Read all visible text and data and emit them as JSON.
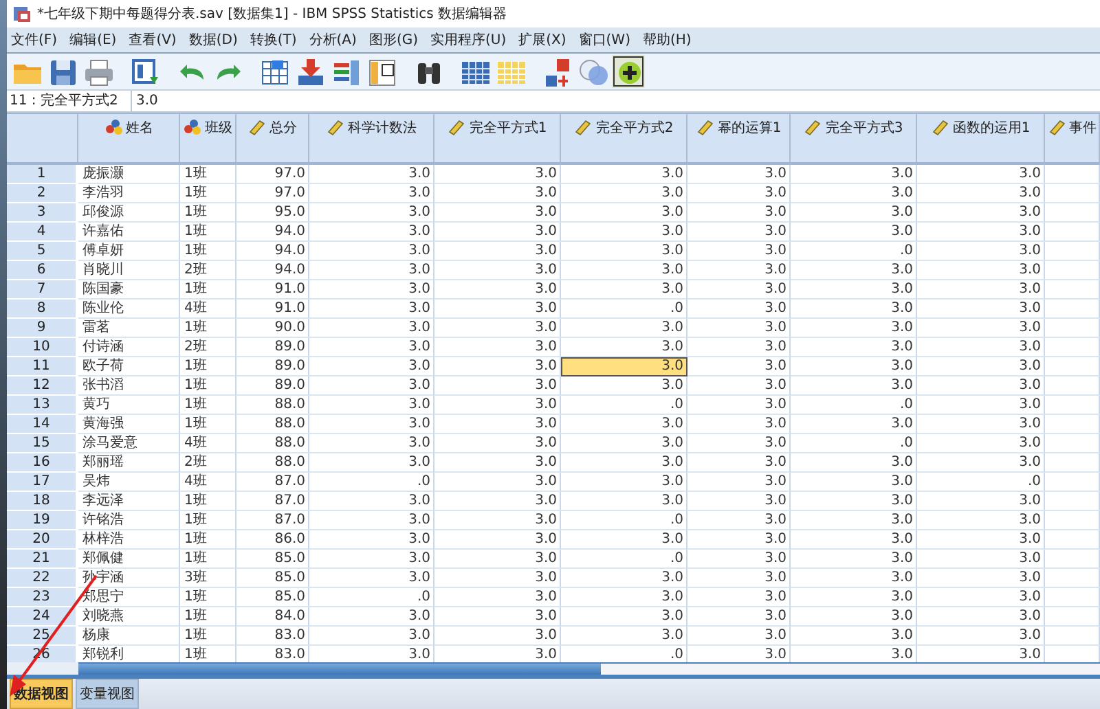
{
  "window": {
    "title": "*七年级下期中每题得分表.sav [数据集1] - IBM SPSS Statistics 数据编辑器"
  },
  "menu": [
    "文件(F)",
    "编辑(E)",
    "查看(V)",
    "数据(D)",
    "转换(T)",
    "分析(A)",
    "图形(G)",
    "实用程序(U)",
    "扩展(X)",
    "窗口(W)",
    "帮助(H)"
  ],
  "cell_editor": {
    "cell": "11 : 完全平方式2",
    "value": "3.0"
  },
  "table": {
    "columns": [
      {
        "label": "姓名",
        "kind": "nominal"
      },
      {
        "label": "班级",
        "kind": "nominal"
      },
      {
        "label": "总分",
        "kind": "scale"
      },
      {
        "label": "科学计数法",
        "kind": "scale"
      },
      {
        "label": "完全平方式1",
        "kind": "scale"
      },
      {
        "label": "完全平方式2",
        "kind": "scale"
      },
      {
        "label": "幂的运算1",
        "kind": "scale"
      },
      {
        "label": "完全平方式3",
        "kind": "scale"
      },
      {
        "label": "函数的运用1",
        "kind": "scale"
      },
      {
        "label": "事件",
        "kind": "scale"
      }
    ],
    "rows": [
      {
        "number": "1",
        "cells": [
          {
            "text": "庞振灏",
            "selected": false
          },
          {
            "text": "1班",
            "selected": false
          },
          {
            "text": "97.0",
            "selected": false
          },
          {
            "text": "3.0",
            "selected": false
          },
          {
            "text": "3.0",
            "selected": false
          },
          {
            "text": "3.0",
            "selected": false
          },
          {
            "text": "3.0",
            "selected": false
          },
          {
            "text": "3.0",
            "selected": false
          },
          {
            "text": "3.0",
            "selected": false
          }
        ]
      },
      {
        "number": "2",
        "cells": [
          {
            "text": "李浩羽",
            "selected": false
          },
          {
            "text": "1班",
            "selected": false
          },
          {
            "text": "97.0",
            "selected": false
          },
          {
            "text": "3.0",
            "selected": false
          },
          {
            "text": "3.0",
            "selected": false
          },
          {
            "text": "3.0",
            "selected": false
          },
          {
            "text": "3.0",
            "selected": false
          },
          {
            "text": "3.0",
            "selected": false
          },
          {
            "text": "3.0",
            "selected": false
          }
        ]
      },
      {
        "number": "3",
        "cells": [
          {
            "text": "邱俊源",
            "selected": false
          },
          {
            "text": "1班",
            "selected": false
          },
          {
            "text": "95.0",
            "selected": false
          },
          {
            "text": "3.0",
            "selected": false
          },
          {
            "text": "3.0",
            "selected": false
          },
          {
            "text": "3.0",
            "selected": false
          },
          {
            "text": "3.0",
            "selected": false
          },
          {
            "text": "3.0",
            "selected": false
          },
          {
            "text": "3.0",
            "selected": false
          }
        ]
      },
      {
        "number": "4",
        "cells": [
          {
            "text": "许嘉佑",
            "selected": false
          },
          {
            "text": "1班",
            "selected": false
          },
          {
            "text": "94.0",
            "selected": false
          },
          {
            "text": "3.0",
            "selected": false
          },
          {
            "text": "3.0",
            "selected": false
          },
          {
            "text": "3.0",
            "selected": false
          },
          {
            "text": "3.0",
            "selected": false
          },
          {
            "text": "3.0",
            "selected": false
          },
          {
            "text": "3.0",
            "selected": false
          }
        ]
      },
      {
        "number": "5",
        "cells": [
          {
            "text": "傅卓妍",
            "selected": false
          },
          {
            "text": "1班",
            "selected": false
          },
          {
            "text": "94.0",
            "selected": false
          },
          {
            "text": "3.0",
            "selected": false
          },
          {
            "text": "3.0",
            "selected": false
          },
          {
            "text": "3.0",
            "selected": false
          },
          {
            "text": "3.0",
            "selected": false
          },
          {
            "text": ".0",
            "selected": false
          },
          {
            "text": "3.0",
            "selected": false
          }
        ]
      },
      {
        "number": "6",
        "cells": [
          {
            "text": "肖晓川",
            "selected": false
          },
          {
            "text": "2班",
            "selected": false
          },
          {
            "text": "94.0",
            "selected": false
          },
          {
            "text": "3.0",
            "selected": false
          },
          {
            "text": "3.0",
            "selected": false
          },
          {
            "text": "3.0",
            "selected": false
          },
          {
            "text": "3.0",
            "selected": false
          },
          {
            "text": "3.0",
            "selected": false
          },
          {
            "text": "3.0",
            "selected": false
          }
        ]
      },
      {
        "number": "7",
        "cells": [
          {
            "text": "陈国豪",
            "selected": false
          },
          {
            "text": "1班",
            "selected": false
          },
          {
            "text": "91.0",
            "selected": false
          },
          {
            "text": "3.0",
            "selected": false
          },
          {
            "text": "3.0",
            "selected": false
          },
          {
            "text": "3.0",
            "selected": false
          },
          {
            "text": "3.0",
            "selected": false
          },
          {
            "text": "3.0",
            "selected": false
          },
          {
            "text": "3.0",
            "selected": false
          }
        ]
      },
      {
        "number": "8",
        "cells": [
          {
            "text": "陈业伦",
            "selected": false
          },
          {
            "text": "4班",
            "selected": false
          },
          {
            "text": "91.0",
            "selected": false
          },
          {
            "text": "3.0",
            "selected": false
          },
          {
            "text": "3.0",
            "selected": false
          },
          {
            "text": ".0",
            "selected": false
          },
          {
            "text": "3.0",
            "selected": false
          },
          {
            "text": "3.0",
            "selected": false
          },
          {
            "text": "3.0",
            "selected": false
          }
        ]
      },
      {
        "number": "9",
        "cells": [
          {
            "text": "雷茗",
            "selected": false
          },
          {
            "text": "1班",
            "selected": false
          },
          {
            "text": "90.0",
            "selected": false
          },
          {
            "text": "3.0",
            "selected": false
          },
          {
            "text": "3.0",
            "selected": false
          },
          {
            "text": "3.0",
            "selected": false
          },
          {
            "text": "3.0",
            "selected": false
          },
          {
            "text": "3.0",
            "selected": false
          },
          {
            "text": "3.0",
            "selected": false
          }
        ]
      },
      {
        "number": "10",
        "cells": [
          {
            "text": "付诗涵",
            "selected": false
          },
          {
            "text": "2班",
            "selected": false
          },
          {
            "text": "89.0",
            "selected": false
          },
          {
            "text": "3.0",
            "selected": false
          },
          {
            "text": "3.0",
            "selected": false
          },
          {
            "text": "3.0",
            "selected": false
          },
          {
            "text": "3.0",
            "selected": false
          },
          {
            "text": "3.0",
            "selected": false
          },
          {
            "text": "3.0",
            "selected": false
          }
        ]
      },
      {
        "number": "11",
        "cells": [
          {
            "text": "欧子荷",
            "selected": false
          },
          {
            "text": "1班",
            "selected": false
          },
          {
            "text": "89.0",
            "selected": false
          },
          {
            "text": "3.0",
            "selected": false
          },
          {
            "text": "3.0",
            "selected": false
          },
          {
            "text": "3.0",
            "selected": true
          },
          {
            "text": "3.0",
            "selected": false
          },
          {
            "text": "3.0",
            "selected": false
          },
          {
            "text": "3.0",
            "selected": false
          }
        ]
      },
      {
        "number": "12",
        "cells": [
          {
            "text": "张书滔",
            "selected": false
          },
          {
            "text": "1班",
            "selected": false
          },
          {
            "text": "89.0",
            "selected": false
          },
          {
            "text": "3.0",
            "selected": false
          },
          {
            "text": "3.0",
            "selected": false
          },
          {
            "text": "3.0",
            "selected": false
          },
          {
            "text": "3.0",
            "selected": false
          },
          {
            "text": "3.0",
            "selected": false
          },
          {
            "text": "3.0",
            "selected": false
          }
        ]
      },
      {
        "number": "13",
        "cells": [
          {
            "text": "黄巧",
            "selected": false
          },
          {
            "text": "1班",
            "selected": false
          },
          {
            "text": "88.0",
            "selected": false
          },
          {
            "text": "3.0",
            "selected": false
          },
          {
            "text": "3.0",
            "selected": false
          },
          {
            "text": ".0",
            "selected": false
          },
          {
            "text": "3.0",
            "selected": false
          },
          {
            "text": ".0",
            "selected": false
          },
          {
            "text": "3.0",
            "selected": false
          }
        ]
      },
      {
        "number": "14",
        "cells": [
          {
            "text": "黄海强",
            "selected": false
          },
          {
            "text": "1班",
            "selected": false
          },
          {
            "text": "88.0",
            "selected": false
          },
          {
            "text": "3.0",
            "selected": false
          },
          {
            "text": "3.0",
            "selected": false
          },
          {
            "text": "3.0",
            "selected": false
          },
          {
            "text": "3.0",
            "selected": false
          },
          {
            "text": "3.0",
            "selected": false
          },
          {
            "text": "3.0",
            "selected": false
          }
        ]
      },
      {
        "number": "15",
        "cells": [
          {
            "text": "涂马爱意",
            "selected": false
          },
          {
            "text": "4班",
            "selected": false
          },
          {
            "text": "88.0",
            "selected": false
          },
          {
            "text": "3.0",
            "selected": false
          },
          {
            "text": "3.0",
            "selected": false
          },
          {
            "text": "3.0",
            "selected": false
          },
          {
            "text": "3.0",
            "selected": false
          },
          {
            "text": ".0",
            "selected": false
          },
          {
            "text": "3.0",
            "selected": false
          }
        ]
      },
      {
        "number": "16",
        "cells": [
          {
            "text": "郑丽瑶",
            "selected": false
          },
          {
            "text": "2班",
            "selected": false
          },
          {
            "text": "88.0",
            "selected": false
          },
          {
            "text": "3.0",
            "selected": false
          },
          {
            "text": "3.0",
            "selected": false
          },
          {
            "text": "3.0",
            "selected": false
          },
          {
            "text": "3.0",
            "selected": false
          },
          {
            "text": "3.0",
            "selected": false
          },
          {
            "text": "3.0",
            "selected": false
          }
        ]
      },
      {
        "number": "17",
        "cells": [
          {
            "text": "吴炜",
            "selected": false
          },
          {
            "text": "4班",
            "selected": false
          },
          {
            "text": "87.0",
            "selected": false
          },
          {
            "text": ".0",
            "selected": false
          },
          {
            "text": "3.0",
            "selected": false
          },
          {
            "text": "3.0",
            "selected": false
          },
          {
            "text": "3.0",
            "selected": false
          },
          {
            "text": "3.0",
            "selected": false
          },
          {
            "text": ".0",
            "selected": false
          }
        ]
      },
      {
        "number": "18",
        "cells": [
          {
            "text": "李远泽",
            "selected": false
          },
          {
            "text": "1班",
            "selected": false
          },
          {
            "text": "87.0",
            "selected": false
          },
          {
            "text": "3.0",
            "selected": false
          },
          {
            "text": "3.0",
            "selected": false
          },
          {
            "text": "3.0",
            "selected": false
          },
          {
            "text": "3.0",
            "selected": false
          },
          {
            "text": "3.0",
            "selected": false
          },
          {
            "text": "3.0",
            "selected": false
          }
        ]
      },
      {
        "number": "19",
        "cells": [
          {
            "text": "许铭浩",
            "selected": false
          },
          {
            "text": "1班",
            "selected": false
          },
          {
            "text": "87.0",
            "selected": false
          },
          {
            "text": "3.0",
            "selected": false
          },
          {
            "text": "3.0",
            "selected": false
          },
          {
            "text": ".0",
            "selected": false
          },
          {
            "text": "3.0",
            "selected": false
          },
          {
            "text": "3.0",
            "selected": false
          },
          {
            "text": "3.0",
            "selected": false
          }
        ]
      },
      {
        "number": "20",
        "cells": [
          {
            "text": "林梓浩",
            "selected": false
          },
          {
            "text": "1班",
            "selected": false
          },
          {
            "text": "86.0",
            "selected": false
          },
          {
            "text": "3.0",
            "selected": false
          },
          {
            "text": "3.0",
            "selected": false
          },
          {
            "text": "3.0",
            "selected": false
          },
          {
            "text": "3.0",
            "selected": false
          },
          {
            "text": "3.0",
            "selected": false
          },
          {
            "text": "3.0",
            "selected": false
          }
        ]
      },
      {
        "number": "21",
        "cells": [
          {
            "text": "郑佩健",
            "selected": false
          },
          {
            "text": "1班",
            "selected": false
          },
          {
            "text": "85.0",
            "selected": false
          },
          {
            "text": "3.0",
            "selected": false
          },
          {
            "text": "3.0",
            "selected": false
          },
          {
            "text": ".0",
            "selected": false
          },
          {
            "text": "3.0",
            "selected": false
          },
          {
            "text": "3.0",
            "selected": false
          },
          {
            "text": "3.0",
            "selected": false
          }
        ]
      },
      {
        "number": "22",
        "cells": [
          {
            "text": "孙宇涵",
            "selected": false
          },
          {
            "text": "3班",
            "selected": false
          },
          {
            "text": "85.0",
            "selected": false
          },
          {
            "text": "3.0",
            "selected": false
          },
          {
            "text": "3.0",
            "selected": false
          },
          {
            "text": "3.0",
            "selected": false
          },
          {
            "text": "3.0",
            "selected": false
          },
          {
            "text": "3.0",
            "selected": false
          },
          {
            "text": "3.0",
            "selected": false
          }
        ]
      },
      {
        "number": "23",
        "cells": [
          {
            "text": "郑思宁",
            "selected": false
          },
          {
            "text": "1班",
            "selected": false
          },
          {
            "text": "85.0",
            "selected": false
          },
          {
            "text": ".0",
            "selected": false
          },
          {
            "text": "3.0",
            "selected": false
          },
          {
            "text": "3.0",
            "selected": false
          },
          {
            "text": "3.0",
            "selected": false
          },
          {
            "text": "3.0",
            "selected": false
          },
          {
            "text": "3.0",
            "selected": false
          }
        ]
      },
      {
        "number": "24",
        "cells": [
          {
            "text": "刘晓燕",
            "selected": false
          },
          {
            "text": "1班",
            "selected": false
          },
          {
            "text": "84.0",
            "selected": false
          },
          {
            "text": "3.0",
            "selected": false
          },
          {
            "text": "3.0",
            "selected": false
          },
          {
            "text": "3.0",
            "selected": false
          },
          {
            "text": "3.0",
            "selected": false
          },
          {
            "text": "3.0",
            "selected": false
          },
          {
            "text": "3.0",
            "selected": false
          }
        ]
      },
      {
        "number": "25",
        "cells": [
          {
            "text": "杨康",
            "selected": false
          },
          {
            "text": "1班",
            "selected": false
          },
          {
            "text": "83.0",
            "selected": false
          },
          {
            "text": "3.0",
            "selected": false
          },
          {
            "text": "3.0",
            "selected": false
          },
          {
            "text": "3.0",
            "selected": false
          },
          {
            "text": "3.0",
            "selected": false
          },
          {
            "text": "3.0",
            "selected": false
          },
          {
            "text": "3.0",
            "selected": false
          }
        ]
      },
      {
        "number": "26",
        "cells": [
          {
            "text": "郑锐利",
            "selected": false
          },
          {
            "text": "1班",
            "selected": false
          },
          {
            "text": "83.0",
            "selected": false
          },
          {
            "text": "3.0",
            "selected": false
          },
          {
            "text": "3.0",
            "selected": false
          },
          {
            "text": ".0",
            "selected": false
          },
          {
            "text": "3.0",
            "selected": false
          },
          {
            "text": "3.0",
            "selected": false
          },
          {
            "text": "3.0",
            "selected": false
          }
        ]
      }
    ]
  },
  "view_tabs": [
    {
      "label": "数据视图",
      "selected": true
    },
    {
      "label": "变量视图",
      "selected": false
    }
  ]
}
